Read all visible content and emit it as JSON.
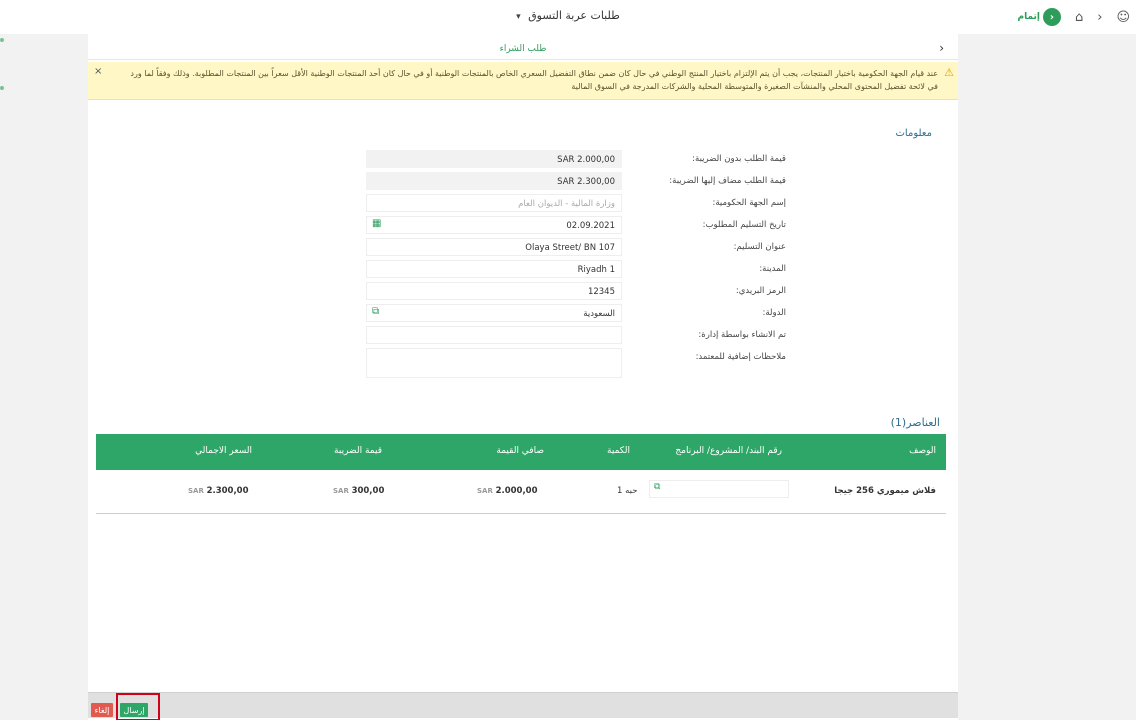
{
  "topbar": {
    "title": "طلبات عربة التسوق",
    "caret": "▾",
    "brand_label": "إتمام",
    "icons": [
      "user-icon",
      "chevron-right-icon",
      "home-icon",
      "brand-logo-icon"
    ]
  },
  "subheader": {
    "title": "طلب الشراء",
    "back_glyph": "›"
  },
  "notice": {
    "text": "عند قيام الجهة الحكومية باختيار المنتجات، يجب أن يتم الإلتزام باختيار المنتج الوطني في حال كان ضمن نطاق التفضيل السعري الخاص بالمنتجات الوطنية أو في حال كان أحد المنتجات الوطنية الأقل سعراً بين المنتجات المطلوبة. وذلك وفقاً لما ورد في لائحة تفضيل المحتوى المحلي والمنشآت الصغيرة والمتوسطة المحلية والشركات المدرجة في السوق المالية",
    "close": "×",
    "warn_glyph": "⚠"
  },
  "info": {
    "title": "معلومات",
    "fields": [
      {
        "label": "قيمة الطلب بدون الضريبة:",
        "value": "SAR 2.000,00"
      },
      {
        "label": "قيمة الطلب مضاف إليها الضريبة:",
        "value": "SAR 2.300,00"
      },
      {
        "label": "إسم الجهة الحكومية:",
        "value": "وزارة المالية - الديوان العام"
      },
      {
        "label": "تاريخ التسليم المطلوب:",
        "value": "02.09.2021"
      },
      {
        "label": "عنوان التسليم:",
        "value": "Olaya Street/ BN 107"
      },
      {
        "label": "المدينة:",
        "value": "Riyadh 1"
      },
      {
        "label": "الرمز البريدي:",
        "value": "12345"
      },
      {
        "label": "الدولة:",
        "value": "السعودية"
      },
      {
        "label": "تم الانشاء بواسطة إدارة:",
        "value": ""
      },
      {
        "label": "ملاحظات إضافية للمعتمد:",
        "value": ""
      }
    ]
  },
  "items": {
    "title": "العناصر(1)",
    "columns": [
      "الوصف",
      "رقم البند/ المشروع/ البرنامج",
      "الكمية",
      "صافي القيمة",
      "قيمة الضريبة",
      "السعر الاجمالي"
    ],
    "rows": [
      {
        "description": "فلاش ميموري 256 جيجا",
        "project": "",
        "quantity": "1 حبه",
        "net_currency": "SAR",
        "net_value": "2.000,00",
        "tax_currency": "SAR",
        "tax_value": "300,00",
        "total_currency": "SAR",
        "total_value": "2.300,00"
      }
    ]
  },
  "footer": {
    "send_label": "إرسال",
    "cancel_label": "إلغاء"
  },
  "colors": {
    "accent_green": "#2ea668",
    "notice_bg": "#fff8c6",
    "cancel_red": "#e05a4f",
    "highlight": "#d0021b"
  }
}
